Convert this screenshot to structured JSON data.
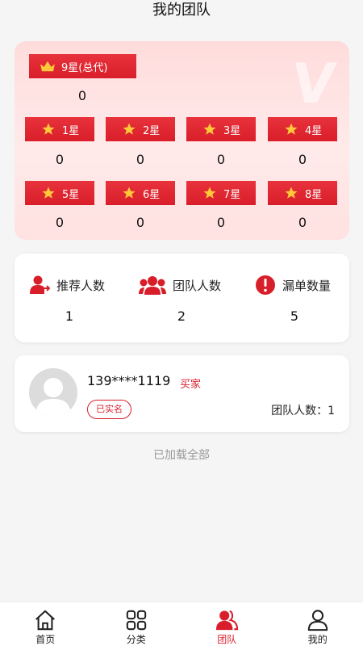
{
  "header": {
    "title": "我的团队"
  },
  "ranks": {
    "top": {
      "label": "9星(总代)",
      "count": "0"
    },
    "levels": [
      {
        "label": "1星",
        "count": "0"
      },
      {
        "label": "2星",
        "count": "0"
      },
      {
        "label": "3星",
        "count": "0"
      },
      {
        "label": "4星",
        "count": "0"
      },
      {
        "label": "5星",
        "count": "0"
      },
      {
        "label": "6星",
        "count": "0"
      },
      {
        "label": "7星",
        "count": "0"
      },
      {
        "label": "8星",
        "count": "0"
      }
    ]
  },
  "stats": [
    {
      "label": "推荐人数",
      "value": "1"
    },
    {
      "label": "团队人数",
      "value": "2"
    },
    {
      "label": "漏单数量",
      "value": "5"
    }
  ],
  "member": {
    "phone": "139****1119",
    "role": "买家",
    "verified": "已实名",
    "team_count": "团队人数：1"
  },
  "load_status": "已加载全部",
  "nav": [
    {
      "label": "首页"
    },
    {
      "label": "分类"
    },
    {
      "label": "团队"
    },
    {
      "label": "我的"
    }
  ],
  "colors": {
    "accent": "#d81e2a",
    "panel": "#ffe4e4"
  }
}
